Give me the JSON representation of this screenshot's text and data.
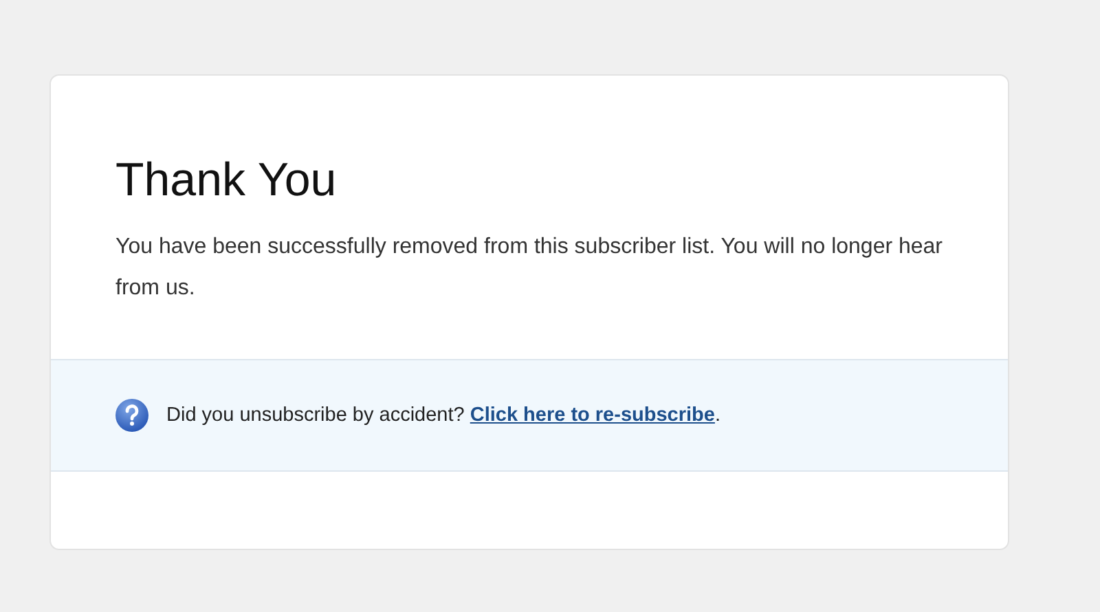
{
  "card": {
    "title": "Thank You",
    "message": "You have been successfully removed from this subscriber list. You will no longer hear from us.",
    "notice": {
      "text": "Did you unsubscribe by accident? ",
      "link": "Click here to re-subscribe",
      "after": "."
    }
  }
}
